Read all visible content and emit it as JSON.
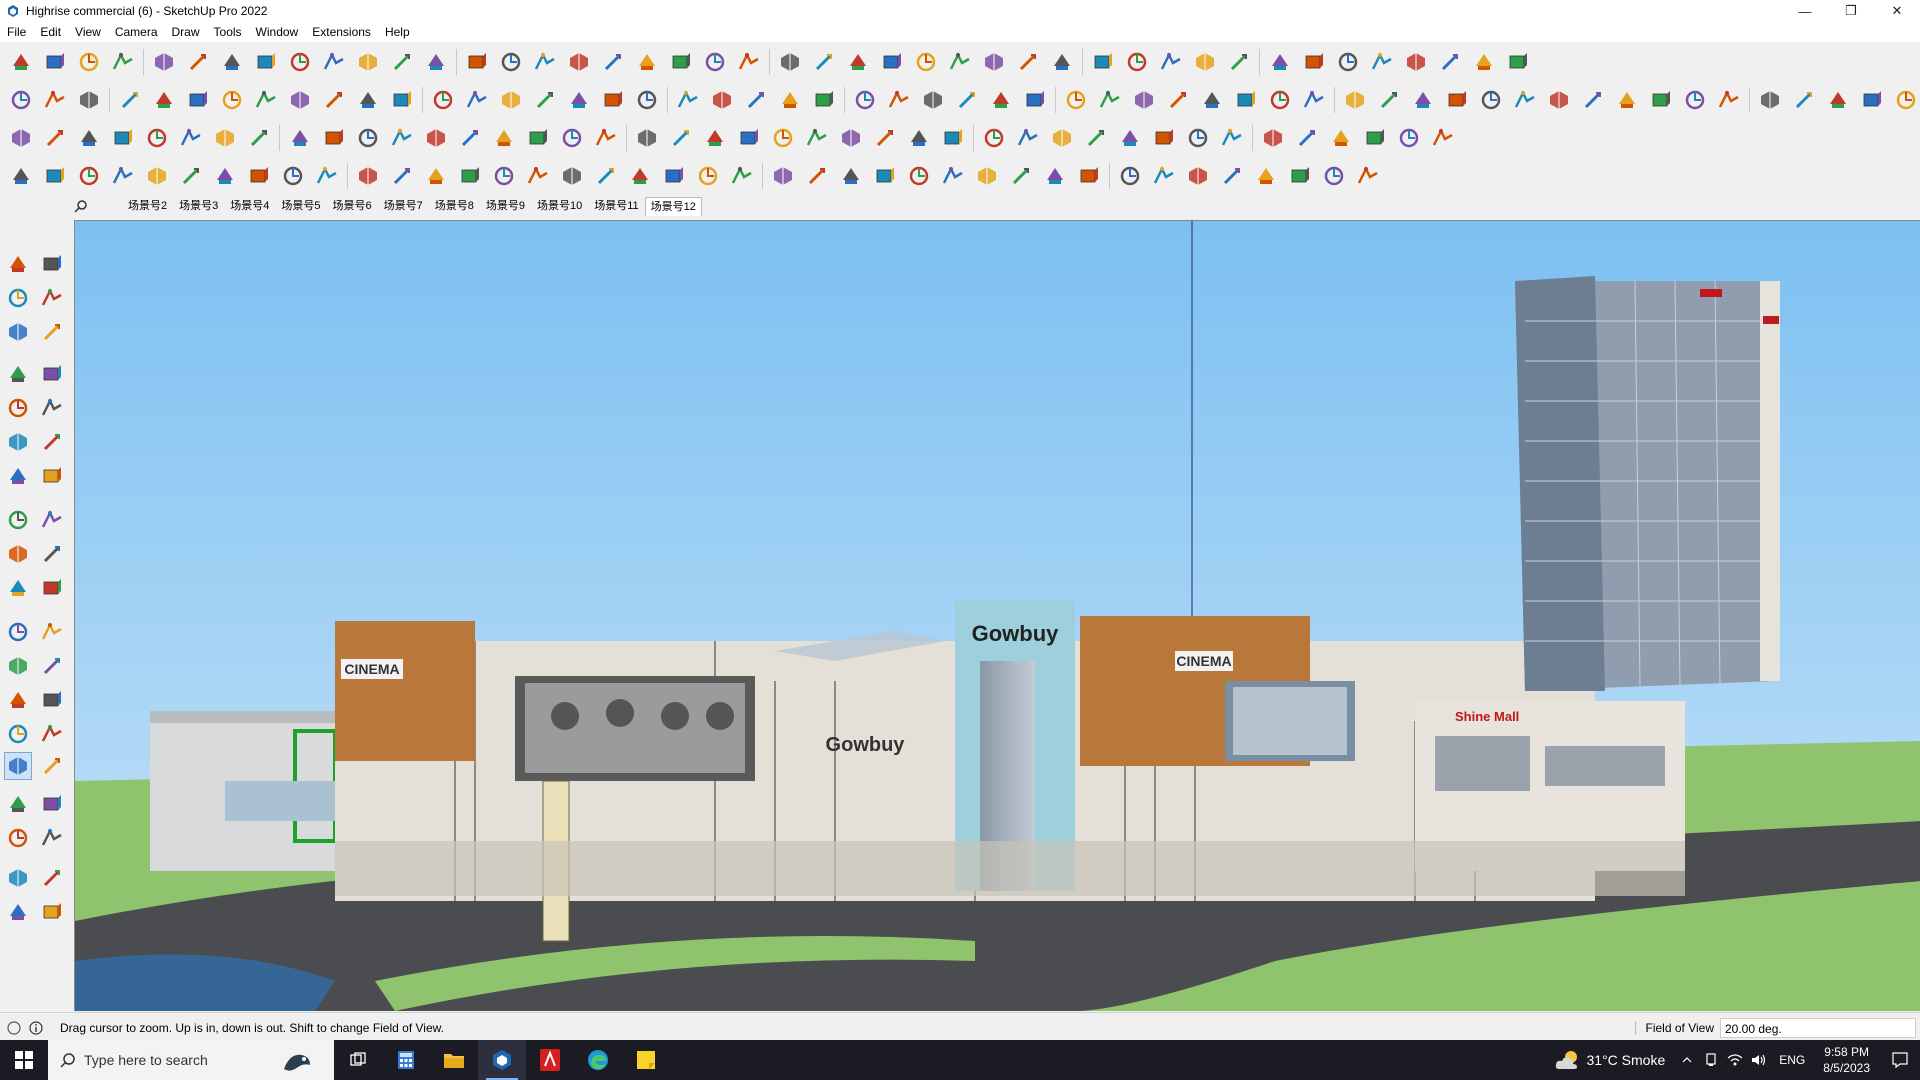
{
  "window": {
    "title": "Highrise commercial (6) - SketchUp Pro 2022",
    "controls": [
      "minimize",
      "restore",
      "close"
    ]
  },
  "menu": [
    "File",
    "Edit",
    "View",
    "Camera",
    "Draw",
    "Tools",
    "Window",
    "Extensions",
    "Help"
  ],
  "scenes": {
    "tabs": [
      "场景号2",
      "场景号3",
      "场景号4",
      "场景号5",
      "场景号6",
      "场景号7",
      "场景号8",
      "场景号9",
      "场景号10",
      "场景号11",
      "场景号12"
    ],
    "active": "场景号12"
  },
  "viewport": {
    "signs": {
      "cinema_left": "CINEMA",
      "cinema_right": "CINEMA",
      "brand_main": "Gowbuy",
      "brand_secondary": "Gowbuy",
      "mall_red": "Shine Mall"
    }
  },
  "status": {
    "message": "Drag cursor to zoom.  Up is in, down is out. Shift to change Field of View.",
    "vcb_label": "Field of View",
    "vcb_value": "20.00 deg."
  },
  "taskbar": {
    "search_placeholder": "Type here to search",
    "weather": "31°C  Smoke",
    "language": "ENG",
    "time": "9:58 PM",
    "date": "8/5/2023"
  },
  "colors": {
    "sky": "#a8d4f5",
    "ground": "#8fc36d",
    "road": "#4a4c50",
    "accent_orange": "#b9773a",
    "taskbar": "#1b1b24"
  }
}
